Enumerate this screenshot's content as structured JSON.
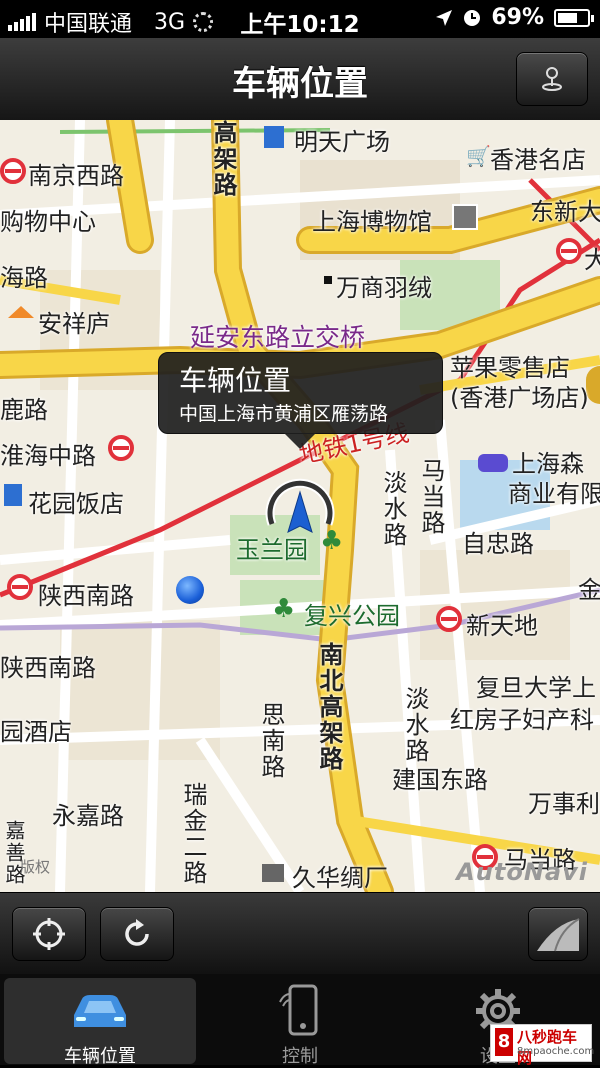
{
  "status_bar": {
    "carrier": "中国联通",
    "network": "3G",
    "time": "上午10:12",
    "battery_text": "69%",
    "battery_level": 0.69
  },
  "nav": {
    "title": "车辆位置",
    "right_button_icon": "map-pin-icon"
  },
  "map": {
    "callout": {
      "title": "车辆位置",
      "address": "中国上海市黄浦区雁荡路"
    },
    "labels": {
      "nanjing_xilu": "南京西路",
      "mingtian_guangchang": "明天广场",
      "xianggang_mingdian": "香港名店",
      "gouwu_zhongxin": "购物中心",
      "shanghai_bowuguan": "上海博物馆",
      "dongxin": "东新大",
      "da": "大",
      "hailu": "海路",
      "wanshang_yurong": "万商羽绒",
      "anxiang_lu": "安祥庐",
      "yanan_lijiaoqiao": "延安东路立交桥",
      "pingguo_lingshou": "苹果零售店",
      "xianggang_guangchang": "(香港广场店)",
      "luolu": "鹿路",
      "huaihai_zhonglu": "淮海中路",
      "ditie_1hao": "地铁1号线",
      "shanghai_sen": "上海森",
      "shangye_you": "商业有限",
      "huayuan_fandian": "花园饭店",
      "danshui_lu": "淡水路",
      "madang_lu": "马当路",
      "zizhong_lu": "自忠路",
      "yulan_yuan": "玉兰园",
      "shanxi_nanlu": "陕西南路",
      "fuxing_gongyuan": "复兴公园",
      "xintiandi": "新天地",
      "jin": "金",
      "shanxi_nanlu_2": "陕西南路",
      "nanbei_gaojia": "南北高架路",
      "fudan_daxue": "复旦大学上",
      "hongfangzi": "红房子妇产科",
      "yuan_jiudian": "园酒店",
      "si_nanlu": "思南路",
      "danshui_lu_2": "淡水路",
      "jianguo_donglu": "建国东路",
      "wanshi": "万事利",
      "yongjia_lu": "永嘉路",
      "ruijin_erlu": "瑞金二路",
      "jiuhua_choucheng": "久华绸厂",
      "madang_lu_2": "马当路",
      "gaojia_lu": "高架路",
      "jia_lu": "嘉善路"
    },
    "copyright": "版权",
    "provider_logo": "AutoNavi"
  },
  "toolbar": {
    "locate_icon": "crosshair-icon",
    "refresh_icon": "refresh-icon",
    "page_curl_icon": "page-curl-icon"
  },
  "tabs": [
    {
      "label": "车辆位置",
      "icon": "car-icon",
      "active": true
    },
    {
      "label": "控制",
      "icon": "phone-control-icon",
      "active": false
    },
    {
      "label": "设置",
      "icon": "gear-icon",
      "active": false
    }
  ],
  "watermark": {
    "line1": "八秒跑车网",
    "line2": "8mpaoche.com"
  }
}
